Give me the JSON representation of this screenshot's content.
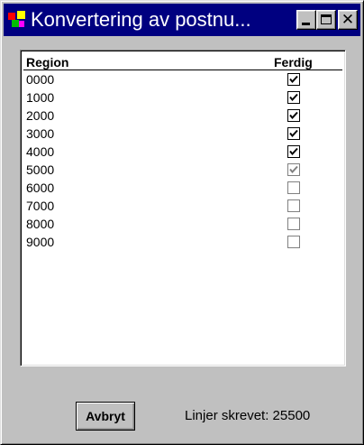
{
  "window": {
    "title": "Konvertering av postnu...",
    "controls": [
      "minimize-icon",
      "maximize-icon",
      "close-icon"
    ],
    "close_glyph": "✕"
  },
  "colors": {
    "title_bar": "#000080",
    "face": "#c0c0c0",
    "list_bg": "#ffffff"
  },
  "list": {
    "columns": [
      "Region",
      "Ferdig"
    ],
    "rows": [
      {
        "region": "0000",
        "done": true,
        "enabled": true
      },
      {
        "region": "1000",
        "done": true,
        "enabled": true
      },
      {
        "region": "2000",
        "done": true,
        "enabled": true
      },
      {
        "region": "3000",
        "done": true,
        "enabled": true
      },
      {
        "region": "4000",
        "done": true,
        "enabled": true
      },
      {
        "region": "5000",
        "done": true,
        "enabled": false
      },
      {
        "region": "6000",
        "done": false,
        "enabled": false
      },
      {
        "region": "7000",
        "done": false,
        "enabled": false
      },
      {
        "region": "8000",
        "done": false,
        "enabled": false
      },
      {
        "region": "9000",
        "done": false,
        "enabled": false
      }
    ]
  },
  "footer": {
    "cancel_label": "Avbryt",
    "status_text": "Linjer skrevet: 25500"
  }
}
